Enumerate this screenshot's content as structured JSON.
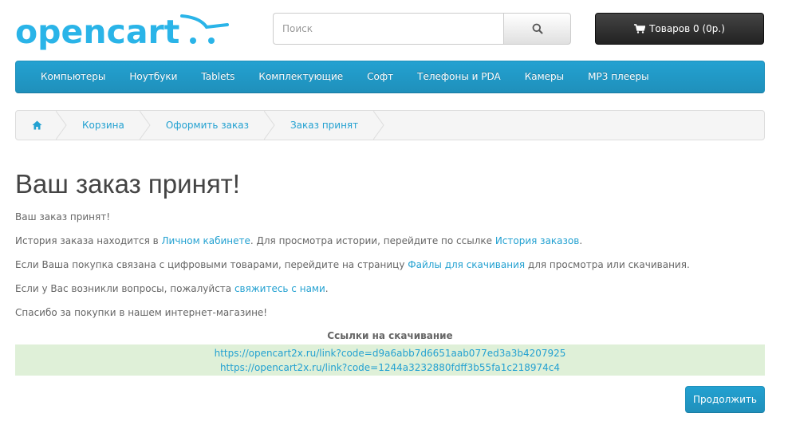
{
  "header": {
    "logo_text": "opencart",
    "search_placeholder": "Поиск",
    "cart_label": "Товаров 0 (0р.)"
  },
  "menu": {
    "items": [
      "Компьютеры",
      "Ноутбуки",
      "Tablets",
      "Комплектующие",
      "Софт",
      "Телефоны и PDA",
      "Камеры",
      "MP3 плееры"
    ]
  },
  "breadcrumb": {
    "items": [
      "Корзина",
      "Оформить заказ",
      "Заказ принят"
    ]
  },
  "content": {
    "title": "Ваш заказ принят!",
    "p1": "Ваш заказ принят!",
    "p2_pre": "История заказа находится в ",
    "p2_link1": "Личном кабинете",
    "p2_mid": ". Для просмотра истории, перейдите по ссылке ",
    "p2_link2": "История заказов",
    "p2_post": ".",
    "p3_pre": "Если Ваша покупка связана с цифровыми товарами, перейдите на страницу ",
    "p3_link": "Файлы для скачивания",
    "p3_post": " для просмотра или скачивания.",
    "p4_pre": "Если у Вас возникли вопросы, пожалуйста ",
    "p4_link": "свяжитесь с нами",
    "p4_post": ".",
    "p5": "Спасибо за покупки в нашем интернет-магазине!"
  },
  "downloads": {
    "title": "Ссылки на скачивание",
    "links": [
      "https://opencart2x.ru/link?code=d9a6abb7d6651aab077ed3a3b4207925",
      "https://opencart2x.ru/link?code=1244a3232880fdff3b55fa1c218974c4"
    ]
  },
  "continue_label": "Продолжить",
  "colors": {
    "accent": "#23a1d1",
    "logo": "#2ab4e8",
    "download_bg": "#dff0d8"
  }
}
